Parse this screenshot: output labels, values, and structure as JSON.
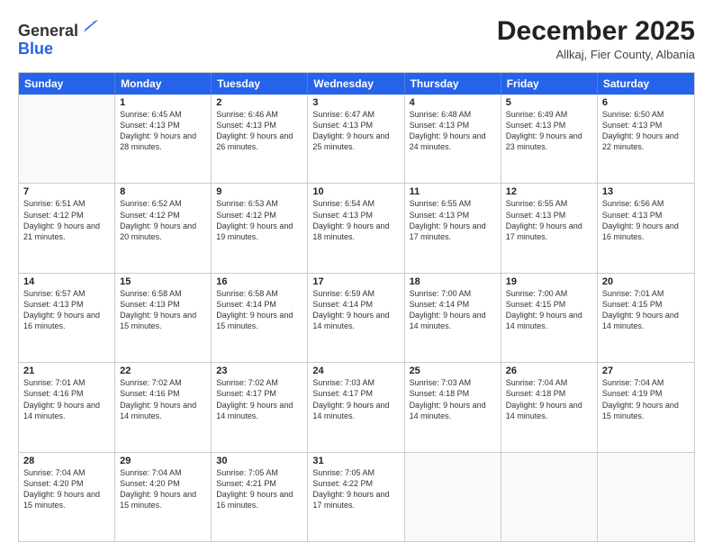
{
  "header": {
    "logo_line1": "General",
    "logo_line2": "Blue",
    "month": "December 2025",
    "location": "Allkaj, Fier County, Albania"
  },
  "day_headers": [
    "Sunday",
    "Monday",
    "Tuesday",
    "Wednesday",
    "Thursday",
    "Friday",
    "Saturday"
  ],
  "weeks": [
    [
      {
        "day": "",
        "sunrise": "",
        "sunset": "",
        "daylight": ""
      },
      {
        "day": "1",
        "sunrise": "6:45 AM",
        "sunset": "4:13 PM",
        "daylight": "9 hours and 28 minutes."
      },
      {
        "day": "2",
        "sunrise": "6:46 AM",
        "sunset": "4:13 PM",
        "daylight": "9 hours and 26 minutes."
      },
      {
        "day": "3",
        "sunrise": "6:47 AM",
        "sunset": "4:13 PM",
        "daylight": "9 hours and 25 minutes."
      },
      {
        "day": "4",
        "sunrise": "6:48 AM",
        "sunset": "4:13 PM",
        "daylight": "9 hours and 24 minutes."
      },
      {
        "day": "5",
        "sunrise": "6:49 AM",
        "sunset": "4:13 PM",
        "daylight": "9 hours and 23 minutes."
      },
      {
        "day": "6",
        "sunrise": "6:50 AM",
        "sunset": "4:13 PM",
        "daylight": "9 hours and 22 minutes."
      }
    ],
    [
      {
        "day": "7",
        "sunrise": "6:51 AM",
        "sunset": "4:12 PM",
        "daylight": "9 hours and 21 minutes."
      },
      {
        "day": "8",
        "sunrise": "6:52 AM",
        "sunset": "4:12 PM",
        "daylight": "9 hours and 20 minutes."
      },
      {
        "day": "9",
        "sunrise": "6:53 AM",
        "sunset": "4:12 PM",
        "daylight": "9 hours and 19 minutes."
      },
      {
        "day": "10",
        "sunrise": "6:54 AM",
        "sunset": "4:13 PM",
        "daylight": "9 hours and 18 minutes."
      },
      {
        "day": "11",
        "sunrise": "6:55 AM",
        "sunset": "4:13 PM",
        "daylight": "9 hours and 17 minutes."
      },
      {
        "day": "12",
        "sunrise": "6:55 AM",
        "sunset": "4:13 PM",
        "daylight": "9 hours and 17 minutes."
      },
      {
        "day": "13",
        "sunrise": "6:56 AM",
        "sunset": "4:13 PM",
        "daylight": "9 hours and 16 minutes."
      }
    ],
    [
      {
        "day": "14",
        "sunrise": "6:57 AM",
        "sunset": "4:13 PM",
        "daylight": "9 hours and 16 minutes."
      },
      {
        "day": "15",
        "sunrise": "6:58 AM",
        "sunset": "4:13 PM",
        "daylight": "9 hours and 15 minutes."
      },
      {
        "day": "16",
        "sunrise": "6:58 AM",
        "sunset": "4:14 PM",
        "daylight": "9 hours and 15 minutes."
      },
      {
        "day": "17",
        "sunrise": "6:59 AM",
        "sunset": "4:14 PM",
        "daylight": "9 hours and 14 minutes."
      },
      {
        "day": "18",
        "sunrise": "7:00 AM",
        "sunset": "4:14 PM",
        "daylight": "9 hours and 14 minutes."
      },
      {
        "day": "19",
        "sunrise": "7:00 AM",
        "sunset": "4:15 PM",
        "daylight": "9 hours and 14 minutes."
      },
      {
        "day": "20",
        "sunrise": "7:01 AM",
        "sunset": "4:15 PM",
        "daylight": "9 hours and 14 minutes."
      }
    ],
    [
      {
        "day": "21",
        "sunrise": "7:01 AM",
        "sunset": "4:16 PM",
        "daylight": "9 hours and 14 minutes."
      },
      {
        "day": "22",
        "sunrise": "7:02 AM",
        "sunset": "4:16 PM",
        "daylight": "9 hours and 14 minutes."
      },
      {
        "day": "23",
        "sunrise": "7:02 AM",
        "sunset": "4:17 PM",
        "daylight": "9 hours and 14 minutes."
      },
      {
        "day": "24",
        "sunrise": "7:03 AM",
        "sunset": "4:17 PM",
        "daylight": "9 hours and 14 minutes."
      },
      {
        "day": "25",
        "sunrise": "7:03 AM",
        "sunset": "4:18 PM",
        "daylight": "9 hours and 14 minutes."
      },
      {
        "day": "26",
        "sunrise": "7:04 AM",
        "sunset": "4:18 PM",
        "daylight": "9 hours and 14 minutes."
      },
      {
        "day": "27",
        "sunrise": "7:04 AM",
        "sunset": "4:19 PM",
        "daylight": "9 hours and 15 minutes."
      }
    ],
    [
      {
        "day": "28",
        "sunrise": "7:04 AM",
        "sunset": "4:20 PM",
        "daylight": "9 hours and 15 minutes."
      },
      {
        "day": "29",
        "sunrise": "7:04 AM",
        "sunset": "4:20 PM",
        "daylight": "9 hours and 15 minutes."
      },
      {
        "day": "30",
        "sunrise": "7:05 AM",
        "sunset": "4:21 PM",
        "daylight": "9 hours and 16 minutes."
      },
      {
        "day": "31",
        "sunrise": "7:05 AM",
        "sunset": "4:22 PM",
        "daylight": "9 hours and 17 minutes."
      },
      {
        "day": "",
        "sunrise": "",
        "sunset": "",
        "daylight": ""
      },
      {
        "day": "",
        "sunrise": "",
        "sunset": "",
        "daylight": ""
      },
      {
        "day": "",
        "sunrise": "",
        "sunset": "",
        "daylight": ""
      }
    ]
  ],
  "labels": {
    "sunrise_prefix": "Sunrise: ",
    "sunset_prefix": "Sunset: ",
    "daylight_prefix": "Daylight: "
  }
}
